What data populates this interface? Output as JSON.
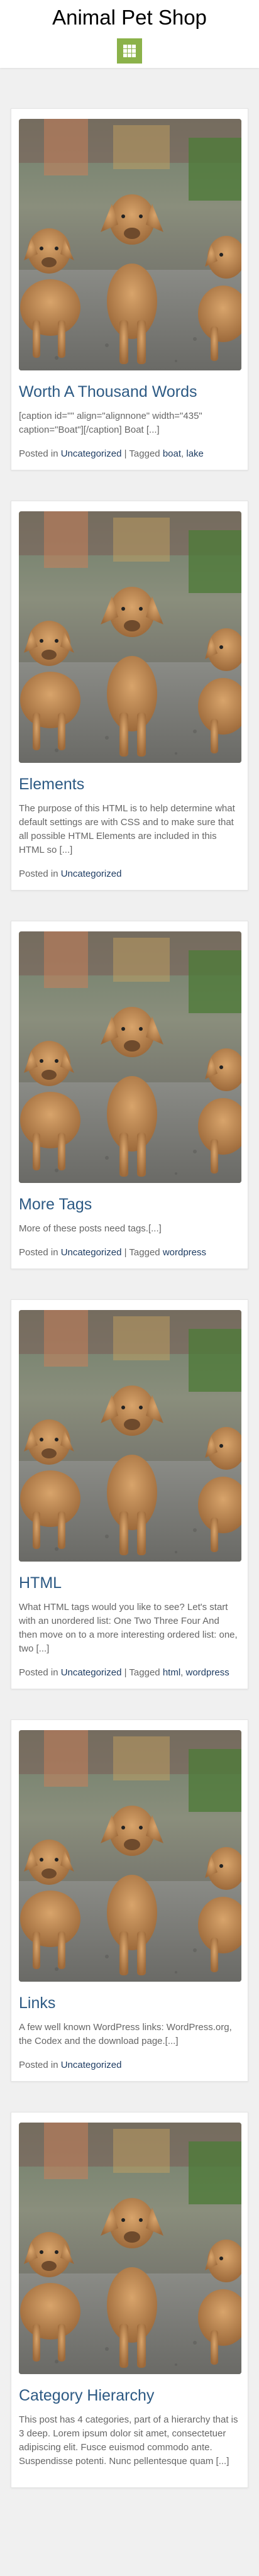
{
  "site": {
    "title": "Animal Pet Shop",
    "menu_icon": "grid-menu-icon",
    "accent_color": "#8bb24a",
    "link_color": "#2d5a84"
  },
  "posts": [
    {
      "title": "Worth A Thousand Words",
      "excerpt": "[caption id=\"\" align=\"alignnone\" width=\"435\" caption=\"Boat\"][/caption] Boat [...]",
      "posted_in_label": "Posted in",
      "category": "Uncategorized",
      "tagged_label": "| Tagged",
      "tags": [
        "boat",
        "lake"
      ]
    },
    {
      "title": "Elements",
      "excerpt": "The purpose of this HTML is to help determine what default settings are with CSS and to make sure that all possible HTML Elements are included in this HTML so [...]",
      "posted_in_label": "Posted in",
      "category": "Uncategorized"
    },
    {
      "title": "More Tags",
      "excerpt": "More of these posts need tags.[...]",
      "posted_in_label": "Posted in",
      "category": "Uncategorized",
      "tagged_label": "| Tagged",
      "tags": [
        "wordpress"
      ]
    },
    {
      "title": "HTML",
      "excerpt": "What HTML tags would you like to see? Let's start with an unordered list: One Two Three Four And then move on to a more interesting ordered list: one, two [...]",
      "posted_in_label": "Posted in",
      "category": "Uncategorized",
      "tagged_label": "| Tagged",
      "tags": [
        "html",
        "wordpress"
      ]
    },
    {
      "title": "Links",
      "excerpt": "A few well known WordPress links: WordPress.org, the Codex and the download page.[...]",
      "posted_in_label": "Posted in",
      "category": "Uncategorized"
    },
    {
      "title": "Category Hierarchy",
      "excerpt": "This post has 4 categories, part of a hierarchy that is 3 deep. Lorem ipsum dolor sit amet, consectetuer adipiscing elit. Fusce euismod commodo ante. Suspendisse potenti. Nunc pellentesque quam [...]"
    }
  ]
}
